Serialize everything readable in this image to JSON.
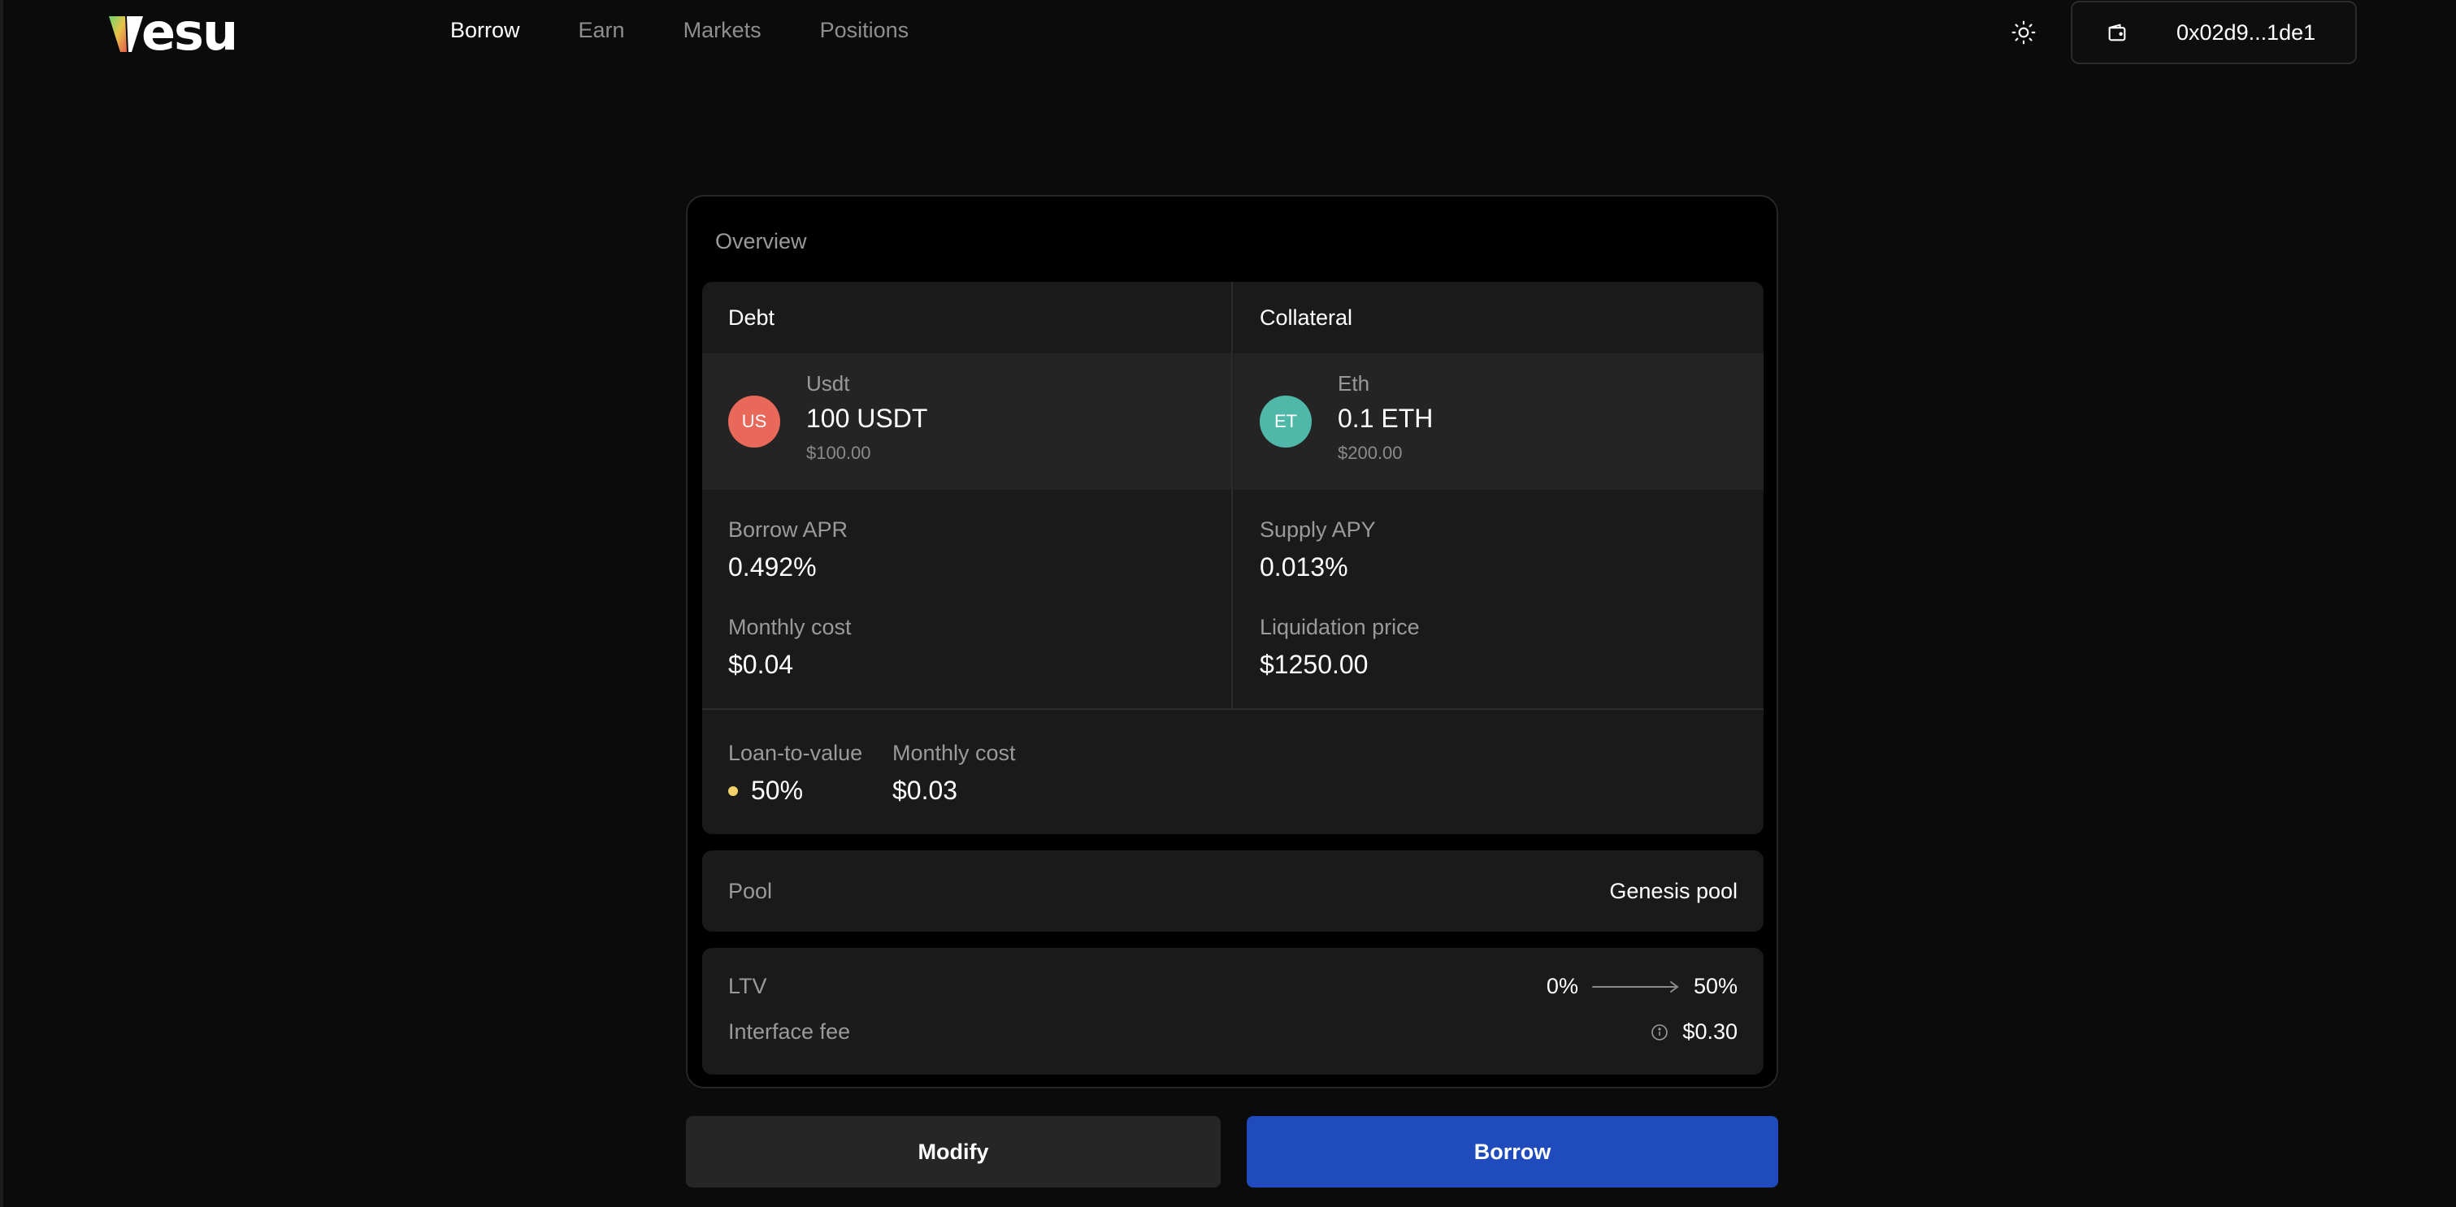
{
  "header": {
    "logo_text": "esu",
    "nav": [
      {
        "label": "Borrow",
        "active": true
      },
      {
        "label": "Earn",
        "active": false
      },
      {
        "label": "Markets",
        "active": false
      },
      {
        "label": "Positions",
        "active": false
      }
    ],
    "theme_icon": "sun-icon",
    "wallet": {
      "icon": "wallet-icon",
      "address": "0x02d9...1de1"
    }
  },
  "overview": {
    "title": "Overview",
    "debt": {
      "heading": "Debt",
      "token": {
        "badge": "US",
        "name": "Usdt",
        "amount": "100 USDT",
        "usd": "$100.00",
        "color": "#e8685a"
      },
      "stat1": {
        "label": "Borrow APR",
        "value": "0.492%"
      },
      "stat2": {
        "label": "Monthly cost",
        "value": "$0.04"
      }
    },
    "collateral": {
      "heading": "Collateral",
      "token": {
        "badge": "ET",
        "name": "Eth",
        "amount": "0.1 ETH",
        "usd": "$200.00",
        "color": "#4fb8a8"
      },
      "stat1": {
        "label": "Supply APY",
        "value": "0.013%"
      },
      "stat2": {
        "label": "Liquidation price",
        "value": "$1250.00"
      }
    },
    "ltv": {
      "label": "Loan-to-value",
      "value": "50%",
      "dot_color": "#f2d36b"
    },
    "monthly_cost": {
      "label": "Monthly cost",
      "value": "$0.03"
    },
    "pool": {
      "label": "Pool",
      "value": "Genesis pool"
    },
    "fees": {
      "ltv": {
        "label": "LTV",
        "from": "0%",
        "to": "50%"
      },
      "interface_fee": {
        "label": "Interface fee",
        "value": "$0.30",
        "icon": "info-icon"
      }
    }
  },
  "actions": {
    "modify": "Modify",
    "borrow": "Borrow"
  },
  "colors": {
    "accent": "#1f4bbd",
    "background": "#0b0b0b"
  }
}
